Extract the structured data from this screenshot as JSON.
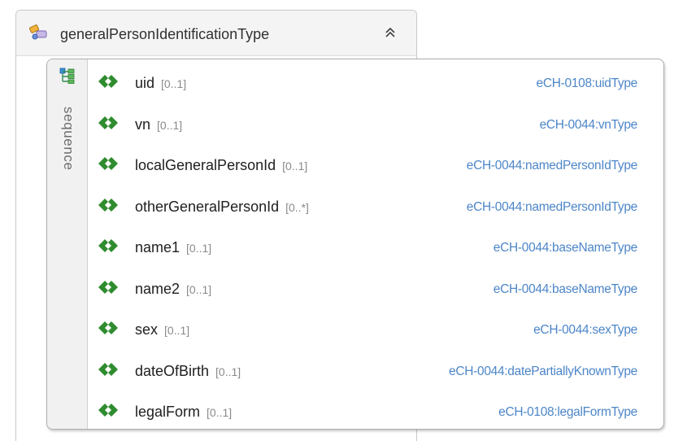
{
  "complex_type": {
    "name": "generalPersonIdentificationType"
  },
  "sequence": {
    "label": "sequence",
    "elements": [
      {
        "name": "uid",
        "cardinality": "[0..1]",
        "type": "eCH-0108:uidType"
      },
      {
        "name": "vn",
        "cardinality": "[0..1]",
        "type": "eCH-0044:vnType"
      },
      {
        "name": "localGeneralPersonId",
        "cardinality": "[0..1]",
        "type": "eCH-0044:namedPersonIdType"
      },
      {
        "name": "otherGeneralPersonId",
        "cardinality": "[0..*]",
        "type": "eCH-0044:namedPersonIdType"
      },
      {
        "name": "name1",
        "cardinality": "[0..1]",
        "type": "eCH-0044:baseNameType"
      },
      {
        "name": "name2",
        "cardinality": "[0..1]",
        "type": "eCH-0044:baseNameType"
      },
      {
        "name": "sex",
        "cardinality": "[0..1]",
        "type": "eCH-0044:sexType"
      },
      {
        "name": "dateOfBirth",
        "cardinality": "[0..1]",
        "type": "eCH-0044:datePartiallyKnownType"
      },
      {
        "name": "legalForm",
        "cardinality": "[0..1]",
        "type": "eCH-0108:legalFormType"
      }
    ]
  },
  "icons": {
    "complex_type": "complex-type-icon",
    "collapse": "double-chevron-up-icon",
    "sequence": "sequence-icon",
    "element": "element-icon"
  },
  "colors": {
    "type_link": "#4d86c8",
    "element_icon": "#2f8c2f",
    "cardinality": "#8a8a8a"
  }
}
